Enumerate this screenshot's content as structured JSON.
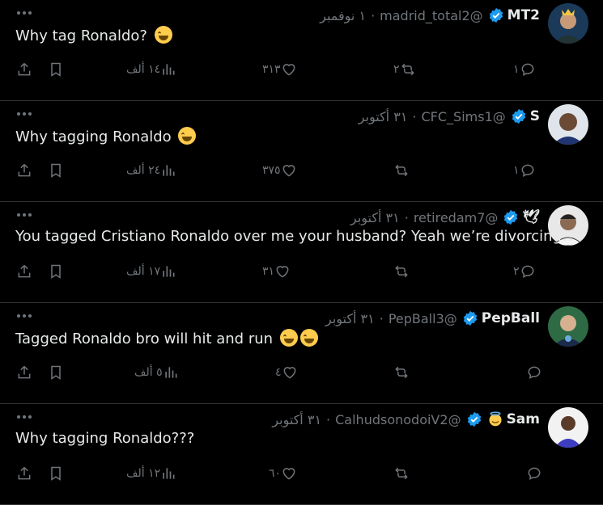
{
  "colors": {
    "background": "#000000",
    "text": "#e7e9ea",
    "muted": "#71767b",
    "verified": "#1d9bf0",
    "divider": "#2f3336"
  },
  "tweets": [
    {
      "name": "MT2",
      "handle": "@madrid_total2",
      "date": "١ نوفمبر",
      "separator": "·",
      "text": "Why tag Ronaldo?",
      "emoji_count": 1,
      "emoji": "face-with-tears-of-joy",
      "replies": "١",
      "retweets": "٢",
      "likes": "٣١٣",
      "views": "١٤ ألف",
      "avatar": "crowned-player-avatar"
    },
    {
      "name": "S",
      "handle": "@CFC_Sims1",
      "date": "٣١ أكتوبر",
      "separator": "·",
      "text": "Why tagging Ronaldo",
      "emoji_count": 1,
      "emoji": "loudly-crying-face",
      "replies": "١",
      "retweets": "",
      "likes": "٣٧٥",
      "views": "٢٤ ألف",
      "avatar": "player-avatar"
    },
    {
      "name": "🕊",
      "handle": "@retiredam7",
      "date": "٣١ أكتوبر",
      "separator": "·",
      "text": "You tagged Cristiano Ronaldo over me your husband? Yeah we’re divorcing!!",
      "emoji_count": 0,
      "emoji": "",
      "replies": "٢",
      "retweets": "",
      "likes": "٣١",
      "views": "١٧ ألف",
      "avatar": "player-avatar"
    },
    {
      "name": "PepBall",
      "handle": "@PepBall3",
      "date": "٣١ أكتوبر",
      "separator": "·",
      "text": "Tagged Ronaldo bro will hit and run",
      "emoji_count": 2,
      "emoji": "face-with-tears-of-joy",
      "replies": "",
      "retweets": "",
      "likes": "٤",
      "views": "٥ ألف",
      "avatar": "manager-avatar"
    },
    {
      "name": "Sam",
      "handle": "@CalhudsonodoiV2",
      "date": "٣١ أكتوبر",
      "separator": "·",
      "text": "Why tagging Ronaldo???",
      "emoji_count": 0,
      "emoji": "",
      "replies": "",
      "retweets": "",
      "likes": "٦٠",
      "views": "١٢ ألف",
      "avatar": "player-avatar",
      "name_emoji": "smiling-face-with-halo"
    }
  ]
}
